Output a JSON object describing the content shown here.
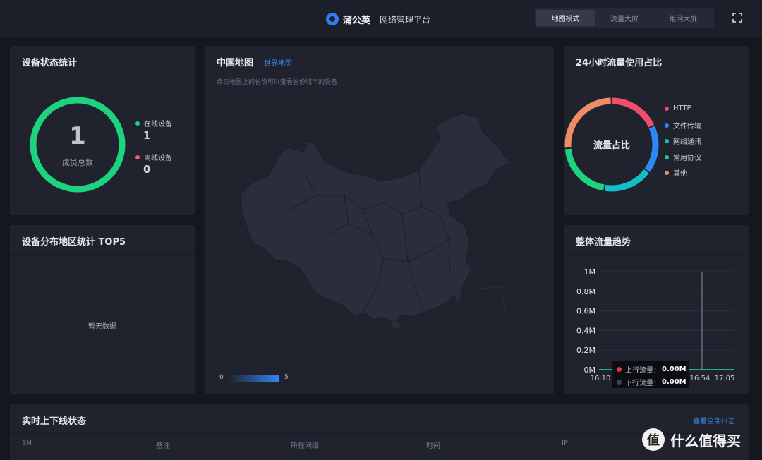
{
  "header": {
    "brand_name": "蒲公英",
    "brand_sub": "网络管理平台",
    "modes": [
      "地图模式",
      "流量大屏",
      "组网大屏"
    ],
    "active_mode": "地图模式"
  },
  "device_status": {
    "title": "设备状态统计",
    "total": "1",
    "total_label": "成员总数",
    "online_label": "在线设备",
    "online_value": "1",
    "offline_label": "离线设备",
    "offline_value": "0",
    "online_color": "#1ed37f",
    "offline_color": "#f4596d"
  },
  "region_top5": {
    "title": "设备分布地区统计 TOP5",
    "empty_text": "暂无数据"
  },
  "map": {
    "title": "中国地图",
    "world_link": "世界地图",
    "hint": "点击地图上的省份可以查看省份城市的设备",
    "scale_min": "0",
    "scale_max": "5"
  },
  "traffic_share": {
    "title": "24小时流量使用占比",
    "center_label": "流量占比",
    "legend": [
      {
        "label": "HTTP",
        "color": "#f24d6a"
      },
      {
        "label": "文件传输",
        "color": "#2f86f5"
      },
      {
        "label": "网络通讯",
        "color": "#0fc2c9"
      },
      {
        "label": "常用协议",
        "color": "#1ed37f"
      },
      {
        "label": "其他",
        "color": "#f08b67"
      }
    ]
  },
  "traffic_trend": {
    "title": "整体流量趋势",
    "tooltip": {
      "up_label": "上行流量：",
      "up_value": "0.00M",
      "up_color": "#e23b3b",
      "down_label": "下行流量：",
      "down_value": "0.00M",
      "down_color": "#3b4552"
    }
  },
  "chart_data": {
    "type": "line",
    "title": "",
    "x": [
      "16:10",
      "16:54",
      "17:05"
    ],
    "series": [
      {
        "name": "上行流量",
        "values": [
          0,
          0,
          0
        ]
      },
      {
        "name": "下行流量",
        "values": [
          0,
          0,
          0
        ]
      }
    ],
    "y_ticks": [
      "0M",
      "0.2M",
      "0.4M",
      "0.6M",
      "0.8M",
      "1M"
    ],
    "ylim": [
      0,
      1
    ],
    "grid": true,
    "crosshair_x": "16:54"
  },
  "realtime": {
    "title": "实时上下线状态",
    "view_all": "查看全部日志",
    "columns": [
      "SN",
      "备注",
      "所在网络",
      "时间",
      "IP"
    ]
  },
  "watermark": {
    "logo": "值",
    "text": "什么值得买"
  }
}
